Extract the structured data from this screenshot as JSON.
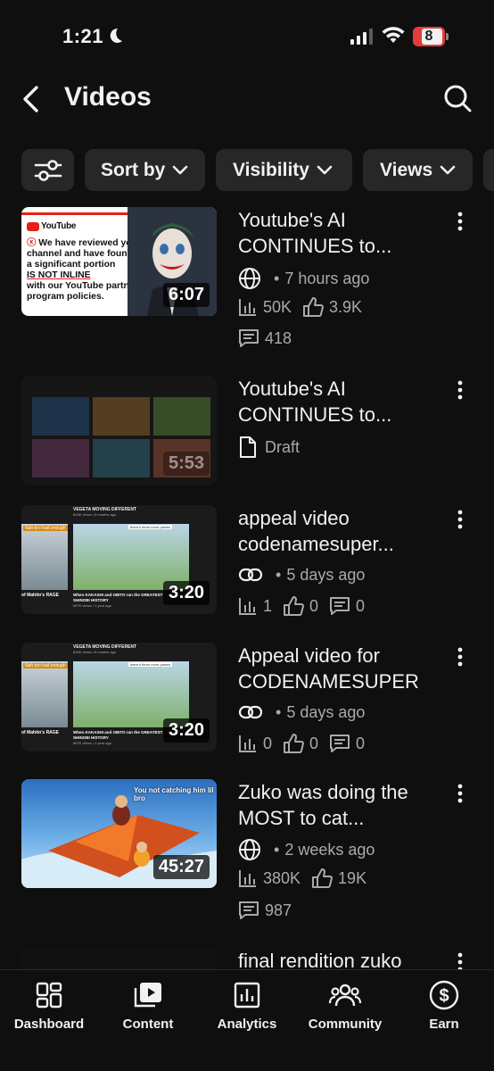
{
  "status": {
    "time": "1:21",
    "battery": "8"
  },
  "header": {
    "title": "Videos"
  },
  "filters": [
    {
      "label": "Sort by"
    },
    {
      "label": "Visibility"
    },
    {
      "label": "Views"
    }
  ],
  "videos": [
    {
      "title": "Youtube's AI CONTINUES to...",
      "duration": "6:07",
      "visibility_icon": "globe-icon",
      "time": "7 hours ago",
      "views": "50K",
      "likes": "3.9K",
      "comments": "418",
      "thumb": {
        "brand": "YouTube",
        "line1": "We have reviewed your",
        "line2": "channel and have found",
        "line3": "a significant portion",
        "line4": "IS NOT INLINE",
        "line5": "with our YouTube partner",
        "line6": "program policies."
      }
    },
    {
      "title": "Youtube's AI CONTINUES to...",
      "duration": "5:53",
      "status": "Draft"
    },
    {
      "title": "appeal video codenamesuper...",
      "duration": "3:20",
      "visibility_icon": "link-icon",
      "time": "5 days ago",
      "views": "1",
      "likes": "0",
      "comments": "0",
      "thumb": {
        "top": "VEGETA MOVING DIFFERENT",
        "topsub": "816K views • 8 months ago",
        "left_caption": "Nah bro had enough",
        "left_title": "of Mahito's RAGE",
        "frame_caption": "there's three more panels",
        "bottom": "When KAKASHI and OBITO ran the GREATEST",
        "bottom2": "SHINOBI HISTORY",
        "bottom3": "667K views • 1 year ago"
      }
    },
    {
      "title": "Appeal video for CODENAMESUPER",
      "duration": "3:20",
      "visibility_icon": "link-icon",
      "time": "5 days ago",
      "views": "0",
      "likes": "0",
      "comments": "0",
      "thumb": {
        "top": "VEGETA MOVING DIFFERENT",
        "topsub": "816K views • 8 months ago",
        "left_caption": "Nah bro had enough",
        "left_title": "of Mahito's RAGE",
        "frame_caption": "there's three more panels",
        "bottom": "When KAKASHI and OBITO ran the GREATEST",
        "bottom2": "SHINOBI HISTORY",
        "bottom3": "667K views • 1 year ago"
      }
    },
    {
      "title": "Zuko was doing the MOST to cat...",
      "duration": "45:27",
      "visibility_icon": "globe-icon",
      "time": "2 weeks ago",
      "views": "380K",
      "likes": "19K",
      "comments": "987",
      "thumb": {
        "caption": "You not catching him lil bro"
      }
    },
    {
      "title": "final rendition zuko"
    }
  ],
  "nav": [
    {
      "label": "Dashboard"
    },
    {
      "label": "Content"
    },
    {
      "label": "Analytics"
    },
    {
      "label": "Community"
    },
    {
      "label": "Earn"
    }
  ]
}
